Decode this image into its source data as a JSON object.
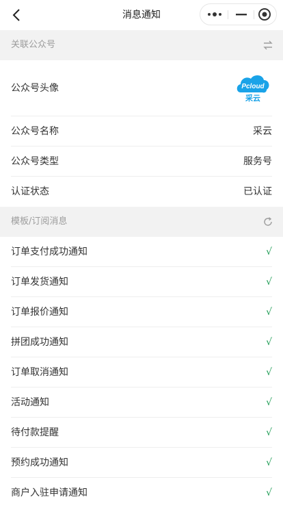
{
  "nav": {
    "title": "消息通知",
    "back_icon": "chevron-left-icon",
    "capsule_icons": [
      "more-dots-icon",
      "minimize-icon",
      "close-target-icon"
    ]
  },
  "sections": {
    "linked_account": {
      "title": "关联公众号",
      "icon": "switch-arrows-icon"
    },
    "template": {
      "title": "模板/订阅消息",
      "icon": "refresh-icon"
    }
  },
  "account": {
    "avatar_label": "公众号头像",
    "logo_text": "Pcloud",
    "logo_subtext": "采云",
    "name_label": "公众号名称",
    "name_value": "采云",
    "type_label": "公众号类型",
    "type_value": "服务号",
    "status_label": "认证状态",
    "status_value": "已认证"
  },
  "notifications": [
    {
      "label": "订单支付成功通知",
      "mark": "√"
    },
    {
      "label": "订单发货通知",
      "mark": "√"
    },
    {
      "label": "订单报价通知",
      "mark": "√"
    },
    {
      "label": "拼团成功通知",
      "mark": "√"
    },
    {
      "label": "订单取消通知",
      "mark": "√"
    },
    {
      "label": "活动通知",
      "mark": "√"
    },
    {
      "label": "待付款提醒",
      "mark": "√"
    },
    {
      "label": "预约成功通知",
      "mark": "√"
    },
    {
      "label": "商户入驻申请通知",
      "mark": "√"
    }
  ],
  "colors": {
    "check": "#1f9d55",
    "section_bg": "#f2f2f2",
    "logo_blue": "#1aa3e8"
  }
}
